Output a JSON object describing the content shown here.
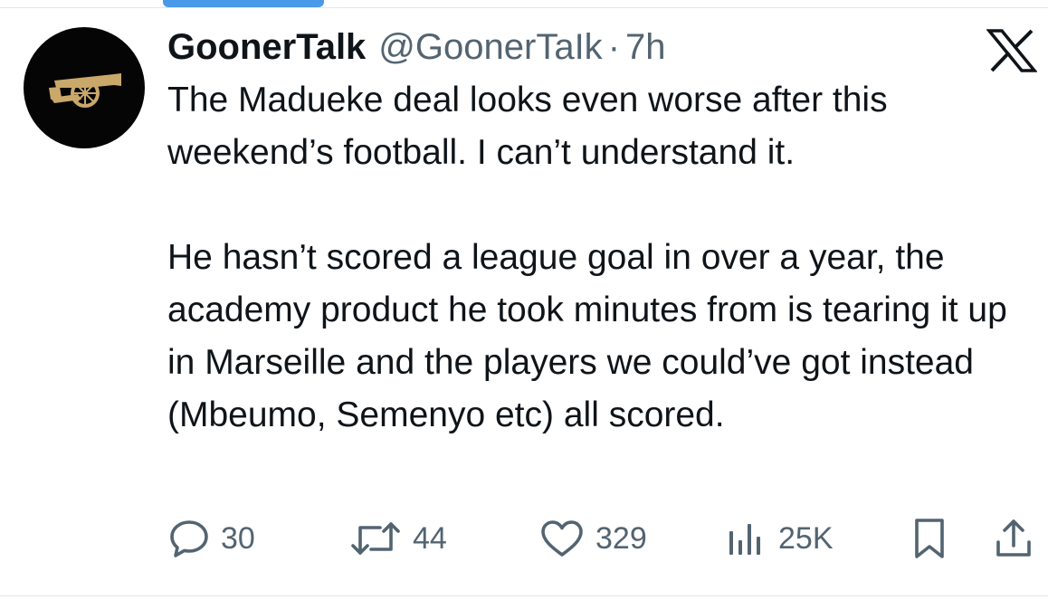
{
  "tweet": {
    "display_name": "GoonerTalk",
    "handle": "@GoonerTaIk",
    "separator": "·",
    "time": "7h",
    "paragraphs": [
      "The Madueke deal looks even worse after this weekend’s football. I can’t understand it.",
      "He hasn’t scored a league goal in over a year, the academy product he took minutes from is tearing it up in Marseille and the players we could’ve got instead (Mbeumo, Semenyo etc) all scored."
    ]
  },
  "actions": {
    "replies": "30",
    "reposts": "44",
    "likes": "329",
    "views": "25K"
  },
  "icons": {
    "avatar": "cannon-logo",
    "brand": "x-logo",
    "reply": "speech-bubble-icon",
    "repost": "repost-arrows-icon",
    "like": "heart-icon",
    "views": "bar-chart-icon",
    "bookmark": "bookmark-icon",
    "share": "share-icon"
  },
  "colors": {
    "text": "#0f1419",
    "secondary": "#536471",
    "avatar_bg": "#050505",
    "cannon": "#c9a86a",
    "accent": "#4a99e9"
  }
}
